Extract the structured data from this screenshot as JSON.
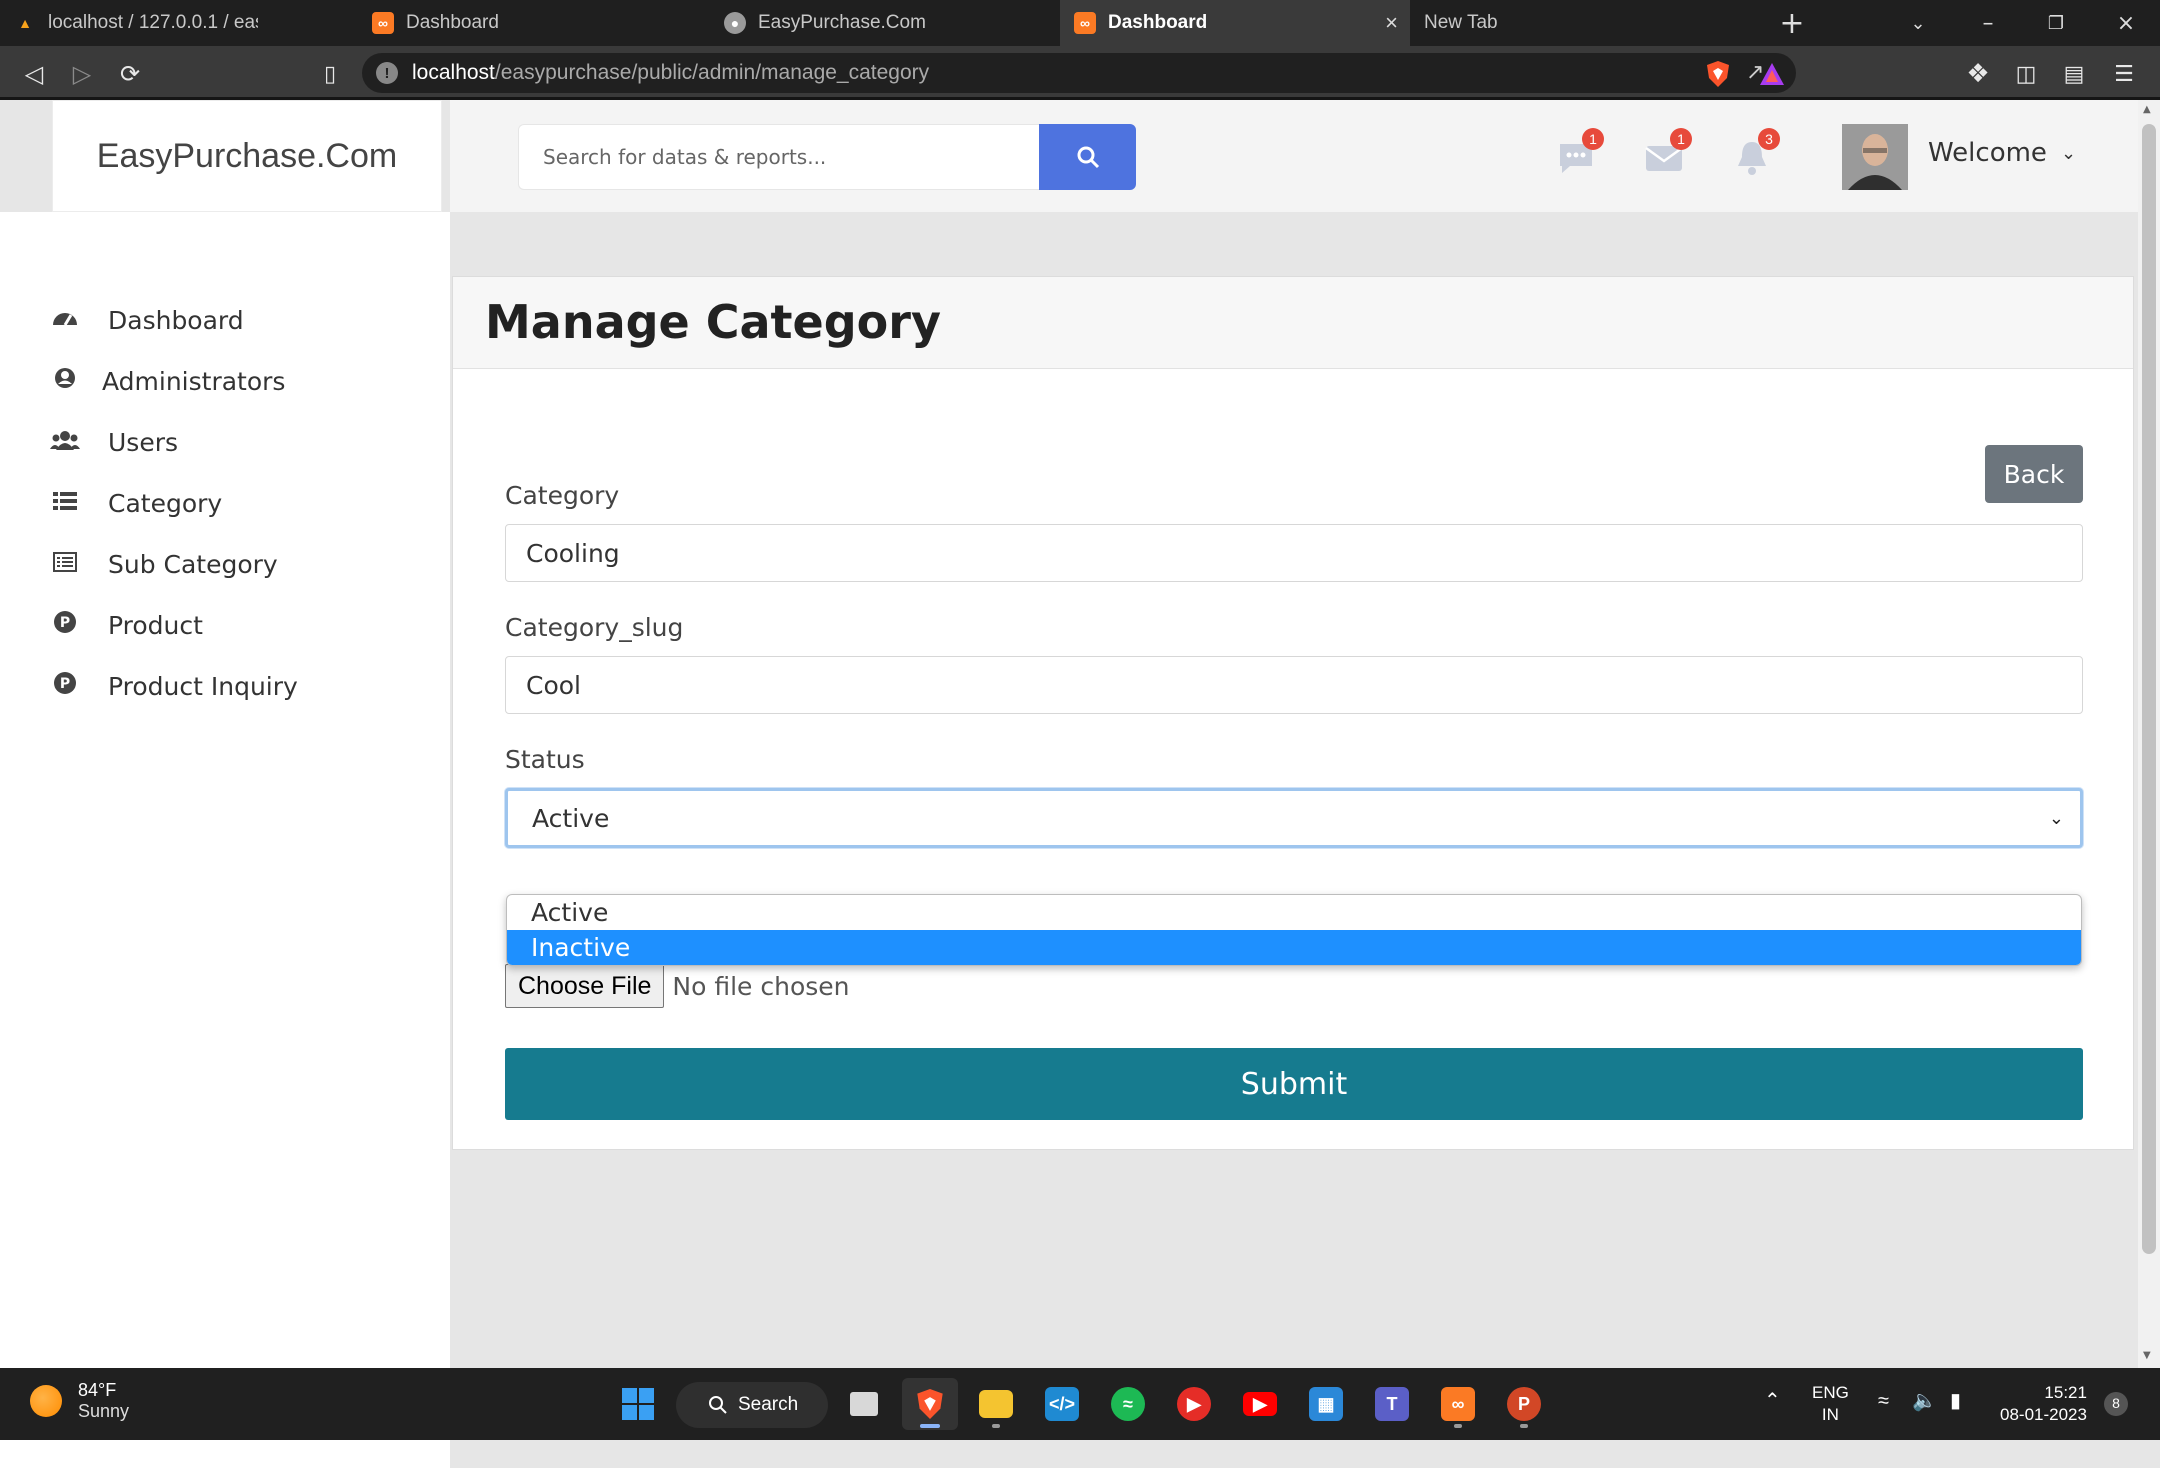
{
  "browser": {
    "tabs": [
      {
        "title": "localhost / 127.0.0.1 / easypurchase / ...",
        "favicon": "phpmyadmin-icon",
        "active": false
      },
      {
        "title": "Dashboard",
        "favicon": "xampp-icon",
        "active": false
      },
      {
        "title": "EasyPurchase.Com",
        "favicon": "globe-icon",
        "active": false
      },
      {
        "title": "Dashboard",
        "favicon": "xampp-icon",
        "active": true
      },
      {
        "title": "New Tab",
        "favicon": "",
        "active": false
      }
    ],
    "url_host": "localhost",
    "url_path": "/easypurchase/public/admin/manage_category",
    "accent": "#fb542b"
  },
  "brand": "EasyPurchase.Com",
  "sidebar": {
    "items": [
      {
        "label": "Dashboard",
        "icon": "tachometer-icon"
      },
      {
        "label": "Administrators",
        "icon": "user-circle-icon"
      },
      {
        "label": "Users",
        "icon": "users-icon"
      },
      {
        "label": "Category",
        "icon": "list-icon"
      },
      {
        "label": "Sub Category",
        "icon": "list-alt-icon"
      },
      {
        "label": "Product",
        "icon": "product-p-icon"
      },
      {
        "label": "Product Inquiry",
        "icon": "product-p-icon"
      }
    ]
  },
  "topbar": {
    "search_placeholder": "Search for datas & reports...",
    "messages_count": "1",
    "mail_count": "1",
    "alerts_count": "3",
    "welcome": "Welcome",
    "primary_color": "#4e73df"
  },
  "form": {
    "title": "Manage Category",
    "back_label": "Back",
    "category_label": "Category",
    "category_value": "Cooling",
    "slug_label": "Category_slug",
    "slug_value": "Cool",
    "status_label": "Status",
    "status_value": "Active",
    "status_options": [
      "Active",
      "Inactive"
    ],
    "status_highlighted": "Inactive",
    "file_button": "Choose File",
    "file_status": "No file chosen",
    "submit_label": "Submit",
    "submit_color": "#167b8f"
  },
  "taskbar": {
    "temperature": "84°F",
    "condition": "Sunny",
    "search_label": "Search",
    "language": "ENG",
    "region": "IN",
    "time": "15:21",
    "date": "08-01-2023",
    "notification_count": "8"
  }
}
